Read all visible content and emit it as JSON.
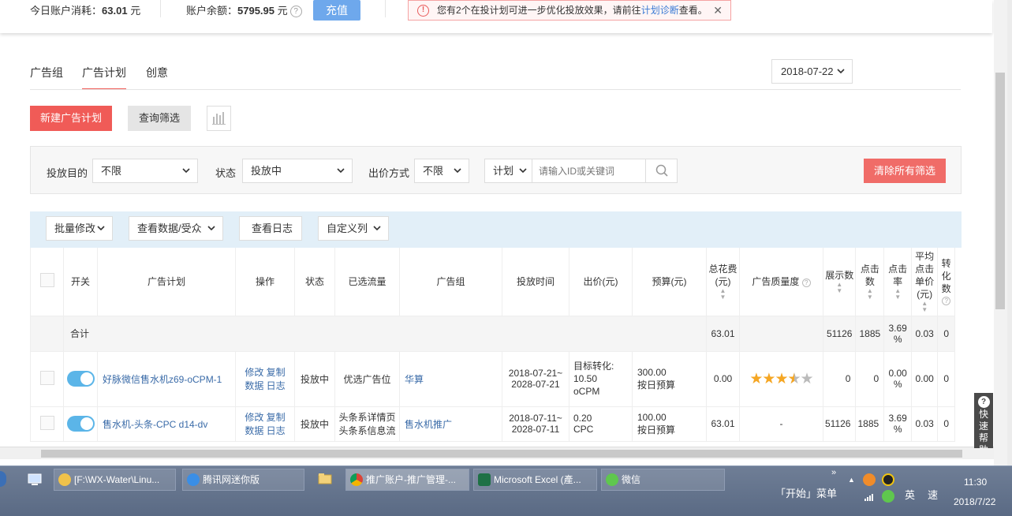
{
  "topbar": {
    "consume_label": "今日账户消耗：",
    "consume_value": "63.01",
    "consume_unit": "元",
    "balance_label": "账户余额：",
    "balance_value": "5795.95",
    "balance_unit": "元",
    "recharge_label": "充值",
    "alert_text": "您有2个在投计划可进一步优化投放效果，请前往",
    "alert_link": "计划诊断",
    "alert_tail": "查看。"
  },
  "tabs": [
    "广告组",
    "广告计划",
    "创意"
  ],
  "date": "2018-07-22",
  "actions": {
    "new_plan": "新建广告计划",
    "query_filter": "查询筛选"
  },
  "filters": {
    "purpose_label": "投放目的",
    "purpose_value": "不限",
    "status_label": "状态",
    "status_value": "投放中",
    "bid_label": "出价方式",
    "bid_value": "不限",
    "search_scope": "计划",
    "search_placeholder": "请输入ID或关键词",
    "clear_all": "清除所有筛选"
  },
  "toolbar": {
    "batch_edit": "批量修改",
    "view_data": "查看数据/受众",
    "view_log": "查看日志",
    "custom_cols": "自定义列"
  },
  "table": {
    "headers": {
      "switch": "开关",
      "plan": "广告计划",
      "op": "操作",
      "status": "状态",
      "traffic": "已选流量",
      "group": "广告组",
      "time": "投放时间",
      "bid": "出价(元)",
      "budget": "预算(元)",
      "cost": "总花费(元)",
      "quality": "广告质量度",
      "impressions": "展示数",
      "clicks": "点击数",
      "ctr": "点击率",
      "cpc": "平均点击单价(元)",
      "conv": "转化数"
    },
    "summary": {
      "label": "合计",
      "cost": "63.01",
      "impressions": "51126",
      "clicks": "1885",
      "ctr": "3.69 %",
      "cpc": "0.03",
      "conv": "0"
    },
    "rows": [
      {
        "plan": "好脉微信售水机z69-oCPM-1",
        "op_edit": "修改",
        "op_copy": "复制",
        "op_data": "数据",
        "op_log": "日志",
        "status": "投放中",
        "traffic": "优选广告位",
        "group": "华算",
        "time_start": "2018-07-21~",
        "time_end": "2028-07-21",
        "bid_line1": "目标转化:",
        "bid_line2": "10.50",
        "bid_line3": "oCPM",
        "budget_value": "300.00",
        "budget_type": "按日预算",
        "cost": "0.00",
        "quality_stars": 3.5,
        "impressions": "0",
        "clicks": "0",
        "ctr": "0.00 %",
        "cpc": "0.00",
        "conv": "0"
      },
      {
        "plan": "售水机-头条-CPC d14-dv",
        "op_edit": "修改",
        "op_copy": "复制",
        "op_data": "数据",
        "op_log": "日志",
        "status": "投放中",
        "traffic_line1": "头条系详情页",
        "traffic_line2": "头条系信息流",
        "group": "售水机推广",
        "time_start": "2018-07-11~",
        "time_end": "2028-07-11",
        "bid_line1": "0.20",
        "bid_line2": "CPC",
        "budget_value": "100.00",
        "budget_type": "按日预算",
        "cost": "63.01",
        "quality": "-",
        "impressions": "51126",
        "clicks": "1885",
        "ctr": "3.69 %",
        "cpc": "0.03",
        "conv": "0"
      }
    ]
  },
  "help_float": "快速帮助",
  "taskbar": {
    "items": [
      "[F:\\WX-Water\\Linu...",
      "腾讯网迷你版",
      "推广账户-推广管理-...",
      "Microsoft Excel (產...",
      "微信"
    ],
    "start_menu": "「开始」菜单",
    "ime_lang": "英",
    "ime_mode": "速",
    "time": "11:30",
    "date": "2018/7/22"
  },
  "colors": {
    "accent_red": "#f05b57",
    "accent_blue": "#6ea8ec",
    "toggle_on": "#5bb5e8",
    "star": "#f5a623"
  }
}
